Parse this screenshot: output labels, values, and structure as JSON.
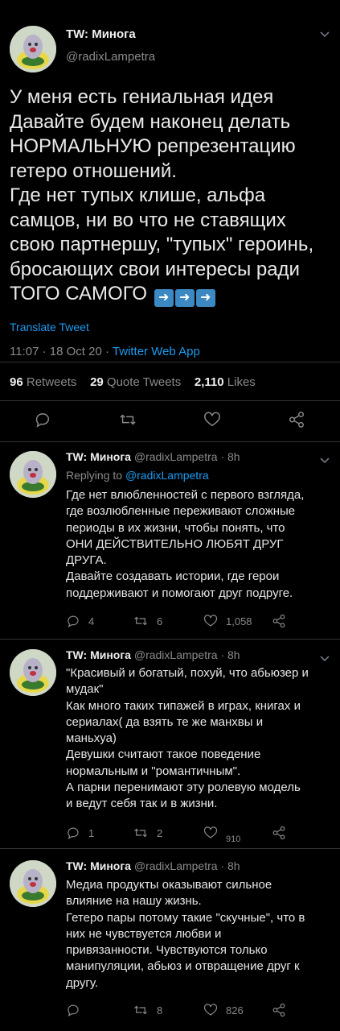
{
  "main_tweet": {
    "author_name": "TW: Минога",
    "author_handle": "@radixLampetra",
    "text_lines": [
      "У меня есть гениальная идея",
      "Давайте будем наконец делать",
      "НОРМАЛЬНУЮ репрезентацию",
      "гетеро отношений.",
      "Где нет тупых клише, альфа",
      "самцов, ни во что не ставящих",
      "свою партнершу, \"тупых\" героинь,",
      "бросающих свои интересы ради",
      "ТОГО САМОГО"
    ],
    "translate_label": "Translate Tweet",
    "time": "11:07 · 18 Oct 20 · ",
    "source": "Twitter Web App",
    "retweets_count": "96",
    "retweets_label": "Retweets",
    "quotes_count": "29",
    "quotes_label": "Quote Tweets",
    "likes_count": "2,110",
    "likes_label": "Likes"
  },
  "replies": [
    {
      "author_name": "TW: Минога",
      "author_handle": "@radixLampetra · 8h",
      "replying_prefix": "Replying to ",
      "replying_to": "@radixLampetra",
      "lines": [
        "Где нет влюбленностей с первого взгляда,",
        "где возлюбленные переживают сложные",
        "периоды в их жизни, чтобы понять, что",
        "ОНИ ДЕЙСТВИТЕЛЬНО ЛЮБЯТ ДРУГ",
        "ДРУГА.",
        "Давайте создавать истории, где герои",
        "поддерживают и помогают друг подруге."
      ],
      "reply_count": "4",
      "retweet_count": "6",
      "like_count": "1,058"
    },
    {
      "author_name": "TW: Минога",
      "author_handle": "@radixLampetra · 8h",
      "lines": [
        "\"Красивый и богатый, похуй, что абьюзер и",
        "мудак\"",
        "Как много таких типажей в играх, книгах и",
        "сериалах( да взять те же манхвы и",
        "маньхуа)",
        "Девушки считают такое поведение",
        "нормальным и \"романтичным\".",
        "А парни перенимают эту ролевую модель",
        "и ведут себя так и в жизни."
      ],
      "reply_count": "1",
      "retweet_count": "2",
      "like_count": "910"
    },
    {
      "author_name": "TW: Минога",
      "author_handle": "@radixLampetra · 8h",
      "lines": [
        "Медиа продукты оказывают сильное",
        "влияние на нашу жизнь.",
        "Гетеро пары потому такие \"скучные\", что в",
        "них не чувствуется любви и",
        "привязанности. Чувствуются только",
        "манипуляции, абьюз и отвращение друг к",
        "другу."
      ],
      "retweet_count": "8",
      "like_count": "826"
    }
  ],
  "icons": {
    "reply": "reply-icon",
    "retweet": "retweet-icon",
    "like": "heart-icon",
    "share": "share-icon",
    "more": "chevron-down-icon",
    "arrow_emoji": "right-arrow-emoji"
  },
  "colors": {
    "background": "#000000",
    "link": "#1d9bf0",
    "muted": "#8a8a8a"
  }
}
